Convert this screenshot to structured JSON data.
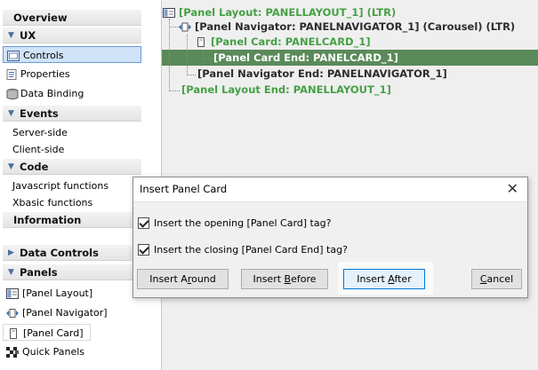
{
  "sidebar": {
    "overview": "Overview",
    "ux": "UX",
    "controls": "Controls",
    "properties": "Properties",
    "data_binding": "Data Binding",
    "events": "Events",
    "server_side": "Server-side",
    "client_side": "Client-side",
    "code": "Code",
    "javascript_functions": "Javascript functions",
    "xbasic_functions": "Xbasic functions",
    "information": "Information",
    "data_controls": "Data Controls",
    "panels": "Panels",
    "panel_layout": "[Panel Layout]",
    "panel_navigator": "[Panel Navigator]",
    "panel_card": "[Panel Card]",
    "quick_panels": "Quick Panels"
  },
  "tree": {
    "panel_layout": "[Panel Layout: PANELLAYOUT_1] (LTR)",
    "panel_navigator": "[Panel Navigator: PANELNAVIGATOR_1] (Carousel) (LTR)",
    "panel_card": "[Panel Card: PANELCARD_1]",
    "panel_card_end": "[Panel Card End: PANELCARD_1]",
    "panel_navigator_end": "[Panel Navigator End: PANELNAVIGATOR_1]",
    "panel_layout_end": "[Panel Layout End: PANELLAYOUT_1]"
  },
  "dialog": {
    "title": "Insert Panel Card",
    "close": "✕",
    "opening_label": "Insert the opening [Panel Card] tag?",
    "closing_label": "Insert the closing [Panel Card End] tag?",
    "opening_checked": true,
    "closing_checked": true,
    "btn_around_a": "Insert A",
    "btn_around_k": "r",
    "btn_around_b": "ound",
    "btn_before_a": "Insert ",
    "btn_before_k": "B",
    "btn_before_b": "efore",
    "btn_after_a": "Insert ",
    "btn_after_k": "A",
    "btn_after_b": "fter",
    "btn_cancel_k": "C",
    "btn_cancel_b": "ancel"
  },
  "colors": {
    "tree_green": "#46a046",
    "selected_row": "#5a8a5a",
    "section_arrow": "#4a6da0",
    "selection_blue": "#cfe3f9"
  },
  "icons": [
    "panel-layout-icon",
    "panel-navigator-icon",
    "panel-card-icon",
    "controls-icon",
    "properties-icon",
    "database-icon",
    "quick-panels-icon",
    "expand-arrow-icon",
    "collapse-arrow-icon",
    "close-icon"
  ]
}
